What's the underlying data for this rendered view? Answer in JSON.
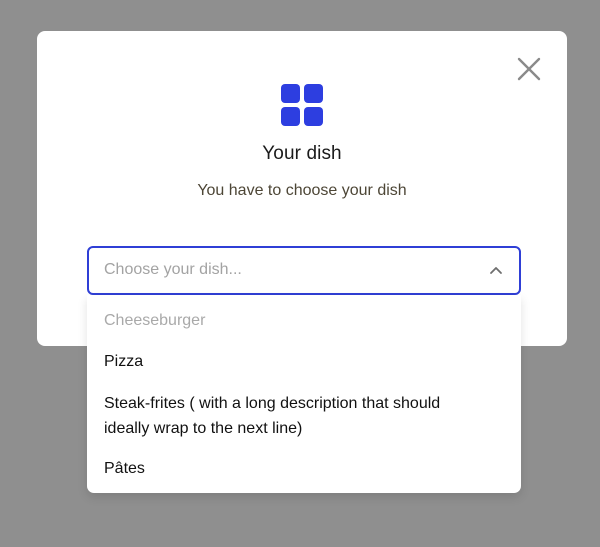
{
  "modal": {
    "title": "Your dish",
    "subtitle": "You have to choose your dish",
    "icons": {
      "close": "close-icon",
      "dish": "grid-icon"
    },
    "colors": {
      "accent": "#2f3fd6",
      "icon": "#2d3ee0",
      "overlay": "#8f8f8f"
    }
  },
  "select": {
    "placeholder": "Choose your dish...",
    "state": "open",
    "options": [
      {
        "label": "Cheeseburger",
        "disabled": true
      },
      {
        "label": "Pizza",
        "disabled": false
      },
      {
        "label": "Steak-frites ( with a long description that should ideally wrap to the next line)",
        "disabled": false
      },
      {
        "label": "Pâtes",
        "disabled": false
      }
    ]
  }
}
